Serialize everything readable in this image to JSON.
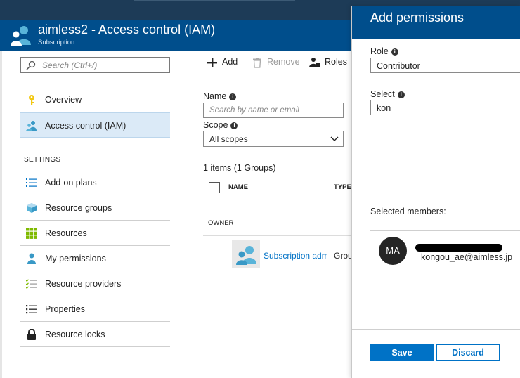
{
  "blade": {
    "title": "aimless2 - Access control (IAM)",
    "subtitle": "Subscription"
  },
  "menu": {
    "search_placeholder": "Search (Ctrl+/)",
    "top_items": [
      {
        "label": "Overview",
        "icon": "key-icon"
      },
      {
        "label": "Access control (IAM)",
        "icon": "users-icon"
      }
    ],
    "section_title": "SETTINGS",
    "settings_items": [
      {
        "label": "Add-on plans",
        "icon": "list-icon"
      },
      {
        "label": "Resource groups",
        "icon": "cube-icon"
      },
      {
        "label": "Resources",
        "icon": "grid-icon"
      },
      {
        "label": "My permissions",
        "icon": "person-icon"
      },
      {
        "label": "Resource providers",
        "icon": "checklist-icon"
      },
      {
        "label": "Properties",
        "icon": "properties-icon"
      },
      {
        "label": "Resource locks",
        "icon": "lock-icon"
      }
    ]
  },
  "toolbar": {
    "add_label": "Add",
    "remove_label": "Remove",
    "roles_label": "Roles"
  },
  "filters": {
    "name_label": "Name",
    "name_placeholder": "Search by name or email",
    "scope_label": "Scope",
    "scope_value": "All scopes"
  },
  "table": {
    "count_text": "1 items (1 Groups)",
    "col_name": "NAME",
    "col_type": "TYPE",
    "group_label": "OWNER",
    "rows": [
      {
        "name": "Subscription admins",
        "type": "Group"
      }
    ]
  },
  "panel": {
    "title": "Add permissions",
    "role_label": "Role",
    "role_value": "Contributor",
    "select_label": "Select",
    "select_value": "kon",
    "selected_members_label": "Selected members:",
    "member": {
      "initials": "MA",
      "email": "kongou_ae@aimless.jp"
    },
    "save_label": "Save",
    "discard_label": "Discard"
  },
  "colors": {
    "header_blue": "#004e8c",
    "accent_blue": "#0072c6",
    "selected_bg": "#dbeaf7"
  }
}
